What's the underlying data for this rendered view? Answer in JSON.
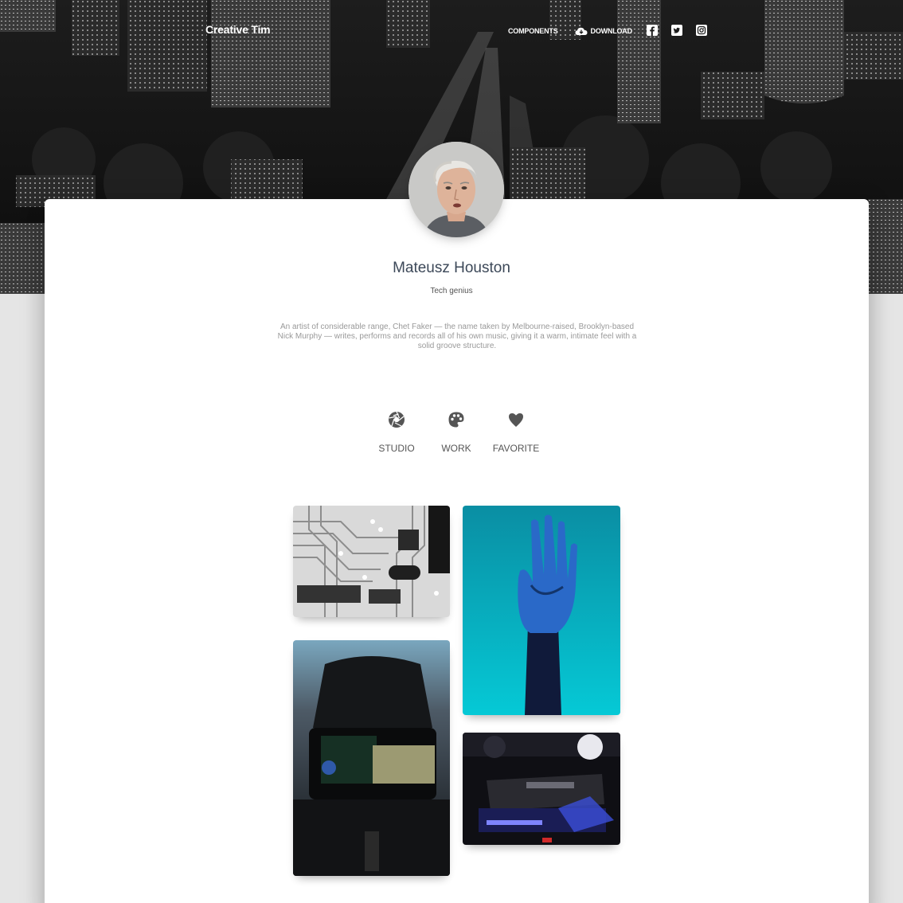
{
  "navbar": {
    "brand": "Creative Tim",
    "links": [
      {
        "label": "Components",
        "icon": "none"
      },
      {
        "label": "Download",
        "icon": "cloud-download-icon"
      }
    ],
    "social": [
      "facebook-square-icon",
      "twitter-square-icon",
      "instagram-icon"
    ]
  },
  "profile": {
    "name": "Mateusz Houston",
    "title": "Tech genius",
    "description": "An artist of considerable range, Chet Faker — the name taken by Melbourne-raised, Brooklyn-based Nick Murphy — writes, performs and records all of his own music, giving it a warm, intimate feel with a solid groove structure."
  },
  "tabs": [
    {
      "label": "Studio",
      "icon": "camera-aperture-icon"
    },
    {
      "label": "Work",
      "icon": "palette-icon"
    },
    {
      "label": "Favorite",
      "icon": "heart-icon"
    }
  ],
  "gallery": [
    {
      "name": "circuit-board-image"
    },
    {
      "name": "robot-hand-image"
    },
    {
      "name": "cockpit-image"
    },
    {
      "name": "gpu-pc-image"
    }
  ],
  "colors": {
    "page_bg": "#e5e5e5",
    "card_bg": "#ffffff",
    "name_text": "#3c4858",
    "muted_text": "#999999"
  }
}
